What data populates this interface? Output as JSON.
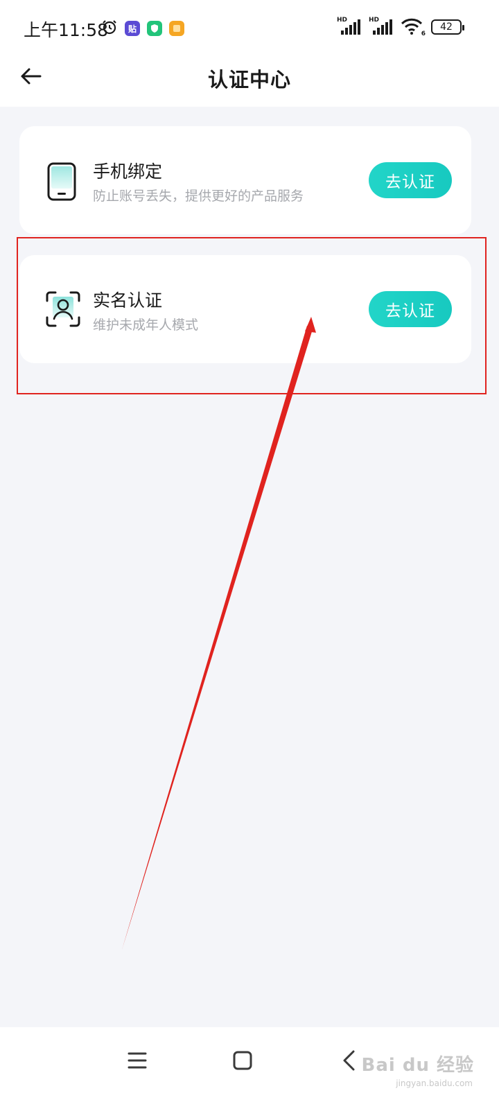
{
  "status_bar": {
    "time": "上午11:58",
    "badge_tie": "贴",
    "battery": "42",
    "hd_label": "HD",
    "wifi_sub": "6"
  },
  "header": {
    "title": "认证中心"
  },
  "cards": [
    {
      "title": "手机绑定",
      "subtitle": "防止账号丢失，提供更好的产品服务",
      "button_label": "去认证"
    },
    {
      "title": "实名认证",
      "subtitle": "维护未成年人模式",
      "button_label": "去认证"
    }
  ],
  "watermark": {
    "text": "Bai du 经验",
    "sub": "jingyan.baidu.com"
  },
  "colors": {
    "accent": "#1ccfc4",
    "annotation": "#e0231f",
    "background": "#f4f5f9"
  }
}
